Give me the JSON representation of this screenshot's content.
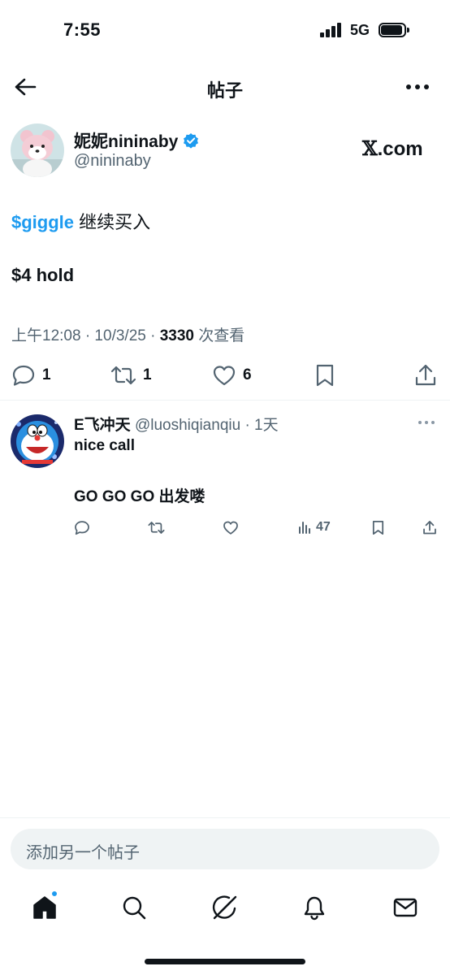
{
  "status_bar": {
    "time": "7:55",
    "network": "5G"
  },
  "header": {
    "title": "帖子"
  },
  "post": {
    "author_name": "妮妮nininaby",
    "author_handle": "@nininaby",
    "source": ".com",
    "source_mark": "𝕏",
    "cashtag": "$giggle",
    "line1_rest": " 继续买入",
    "line2": "$4 hold",
    "meta_time": "上午12:08 · 10/3/25 · ",
    "meta_views_count": "3330",
    "meta_views_label": " 次查看",
    "replies": "1",
    "reposts": "1",
    "likes": "6"
  },
  "reply": {
    "name": "E飞冲天",
    "handle": " @luoshiqianqiu · 1天",
    "line1": "nice call",
    "line2": "GO GO GO 出发喽",
    "views": "47"
  },
  "composer": {
    "placeholder": "添加另一个帖子"
  },
  "colors": {
    "accent": "#1d9bf0",
    "text": "#0f1419",
    "secondary": "#536471",
    "verified": "#1d9bf0"
  },
  "icons": {
    "back": "back-arrow-icon",
    "more": "more-icon",
    "verified": "verified-badge-icon",
    "reply": "reply-icon",
    "repost": "repost-icon",
    "like": "heart-icon",
    "bookmark": "bookmark-icon",
    "share": "share-icon",
    "views": "views-icon",
    "nav": [
      "home-icon",
      "search-icon",
      "grok-icon",
      "notifications-icon",
      "messages-icon"
    ]
  }
}
